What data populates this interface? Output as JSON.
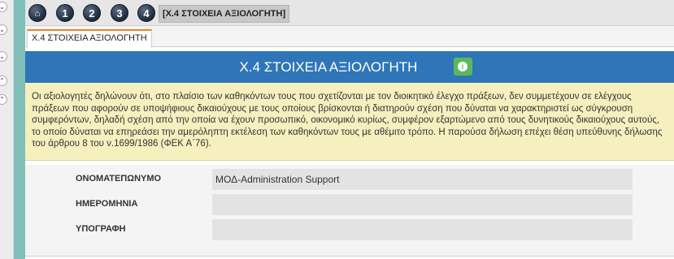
{
  "steps": [
    {
      "label": "⌂",
      "icon": "home-icon"
    },
    {
      "label": "1"
    },
    {
      "label": "2"
    },
    {
      "label": "3"
    },
    {
      "label": "4"
    }
  ],
  "step_label": "[X.4 ΣΤΟΙΧΕΙΑ ΑΞΙΟΛΟΓΗΤΗ]",
  "tab_label": "X.4 ΣΤΟΙΧΕΙΑ ΑΞΙΟΛΟΓΗΤΗ",
  "header": {
    "title": "X.4 ΣΤΟΙΧΕΙΑ ΑΞΙΟΛΟΓΗΤΗ",
    "info_icon": "i"
  },
  "declaration": "Οι αξιολογητές δηλώνουν ότι, στο πλαίσιο των καθηκόντων τους που σχετίζονται με τον διοικητικό έλεγχο πράξεων, δεν συμμετέχουν σε ελέγχους πράξεων που αφορούν σε υποψήφιους δικαιούχους με τους οποίους βρίσκονται ή διατηρούν σχέση που δύναται να χαρακτηριστεί ως σύγκρουση συμφερόντων, δηλαδή σχέση από την οποία να έχουν προσωπικό, οικονομικό κυρίως, συμφέρον εξαρτώμενο από τους δυνητικούς δικαιούχους αυτούς, το οποίο δύναται να επηρεάσει την αμερόληπτη εκτέλεση των καθηκόντων τους με αθέμιτο τρόπο. Η παρούσα δήλωση επέχει θέση υπεύθυνης δήλωσης του άρθρου 8 του ν.1699/1986 (ΦΕΚ Α΄76).",
  "form": {
    "rows": [
      {
        "label": "ΟΝΟΜΑΤΕΠΩΝΥΜΟ",
        "value": "ΜΟΔ-Administration Support"
      },
      {
        "label": "ΗΜΕΡΟΜΗΝΙΑ",
        "value": ""
      },
      {
        "label": "ΥΠΟΓΡΑΦΗ",
        "value": ""
      }
    ]
  },
  "rail_icons": [
    "chevron-down-icon",
    "chevron-down-icon",
    "chevron-down-icon",
    "chevron-up-icon",
    "chevron-up-icon"
  ],
  "colors": {
    "header_bg": "#2f76b8",
    "declaration_bg": "#f6f0bf",
    "info_button": "#5cb85c",
    "tab_accent": "#e8812f"
  }
}
